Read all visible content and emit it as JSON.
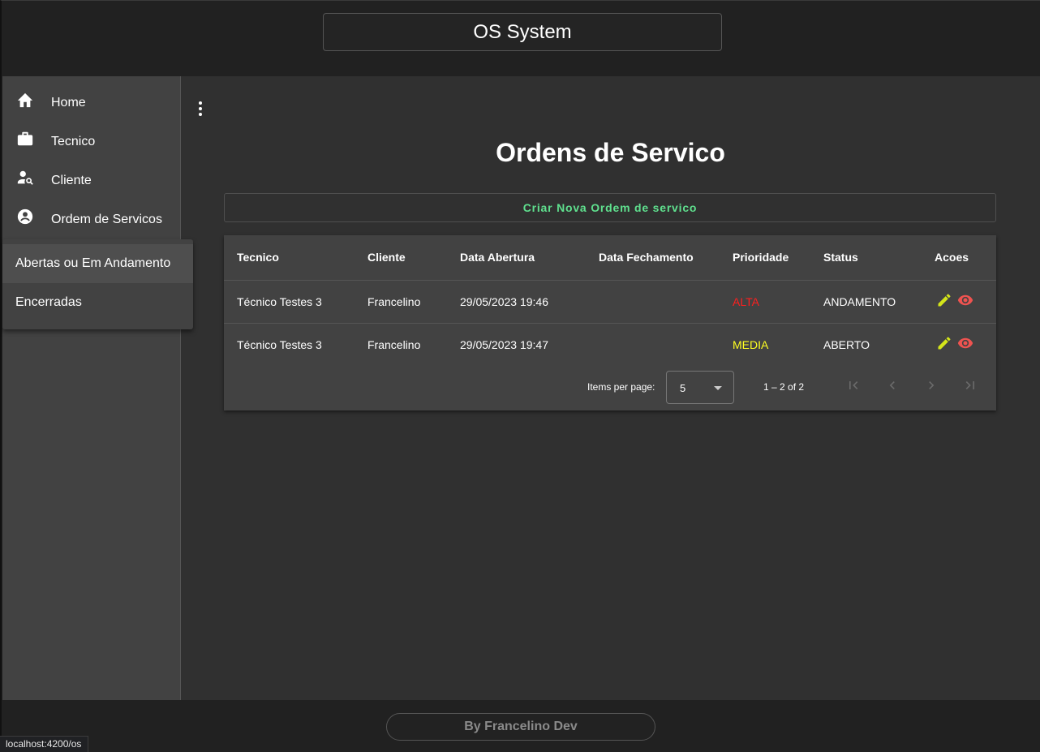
{
  "app": {
    "title": "OS System"
  },
  "sidebar": {
    "items": [
      {
        "label": "Home",
        "icon": "home-icon"
      },
      {
        "label": "Tecnico",
        "icon": "briefcase-icon"
      },
      {
        "label": "Cliente",
        "icon": "person-search-icon"
      },
      {
        "label": "Ordem de Servicos",
        "icon": "account-circle-icon"
      }
    ]
  },
  "submenu": {
    "items": [
      {
        "label": "Abertas ou Em Andamento",
        "active": true
      },
      {
        "label": "Encerradas",
        "active": false
      }
    ]
  },
  "main": {
    "title": "Ordens de Servico",
    "new_button_label": "Criar Nova Ordem de servico"
  },
  "table": {
    "columns": [
      "Tecnico",
      "Cliente",
      "Data Abertura",
      "Data Fechamento",
      "Prioridade",
      "Status",
      "Acoes"
    ],
    "rows": [
      {
        "tecnico": "Técnico Testes 3",
        "cliente": "Francelino",
        "data_abertura": "29/05/2023 19:46",
        "data_fechamento": "",
        "prioridade": "ALTA",
        "status": "ANDAMENTO"
      },
      {
        "tecnico": "Técnico Testes 3",
        "cliente": "Francelino",
        "data_abertura": "29/05/2023 19:47",
        "data_fechamento": "",
        "prioridade": "MEDIA",
        "status": "ABERTO"
      }
    ]
  },
  "paginator": {
    "items_per_page_label": "Items per page:",
    "items_per_page_value": "5",
    "range_label": "1 – 2 of 2"
  },
  "footer": {
    "text": "By Francelino Dev"
  },
  "status_bar": {
    "url": "localhost:4200/os"
  },
  "colors": {
    "accent_green": "#5fe08e",
    "priority_alta": "#ff1f1f",
    "priority_media": "#ffff22",
    "edit_icon": "#d4e51a",
    "view_icon": "#ef5350"
  }
}
